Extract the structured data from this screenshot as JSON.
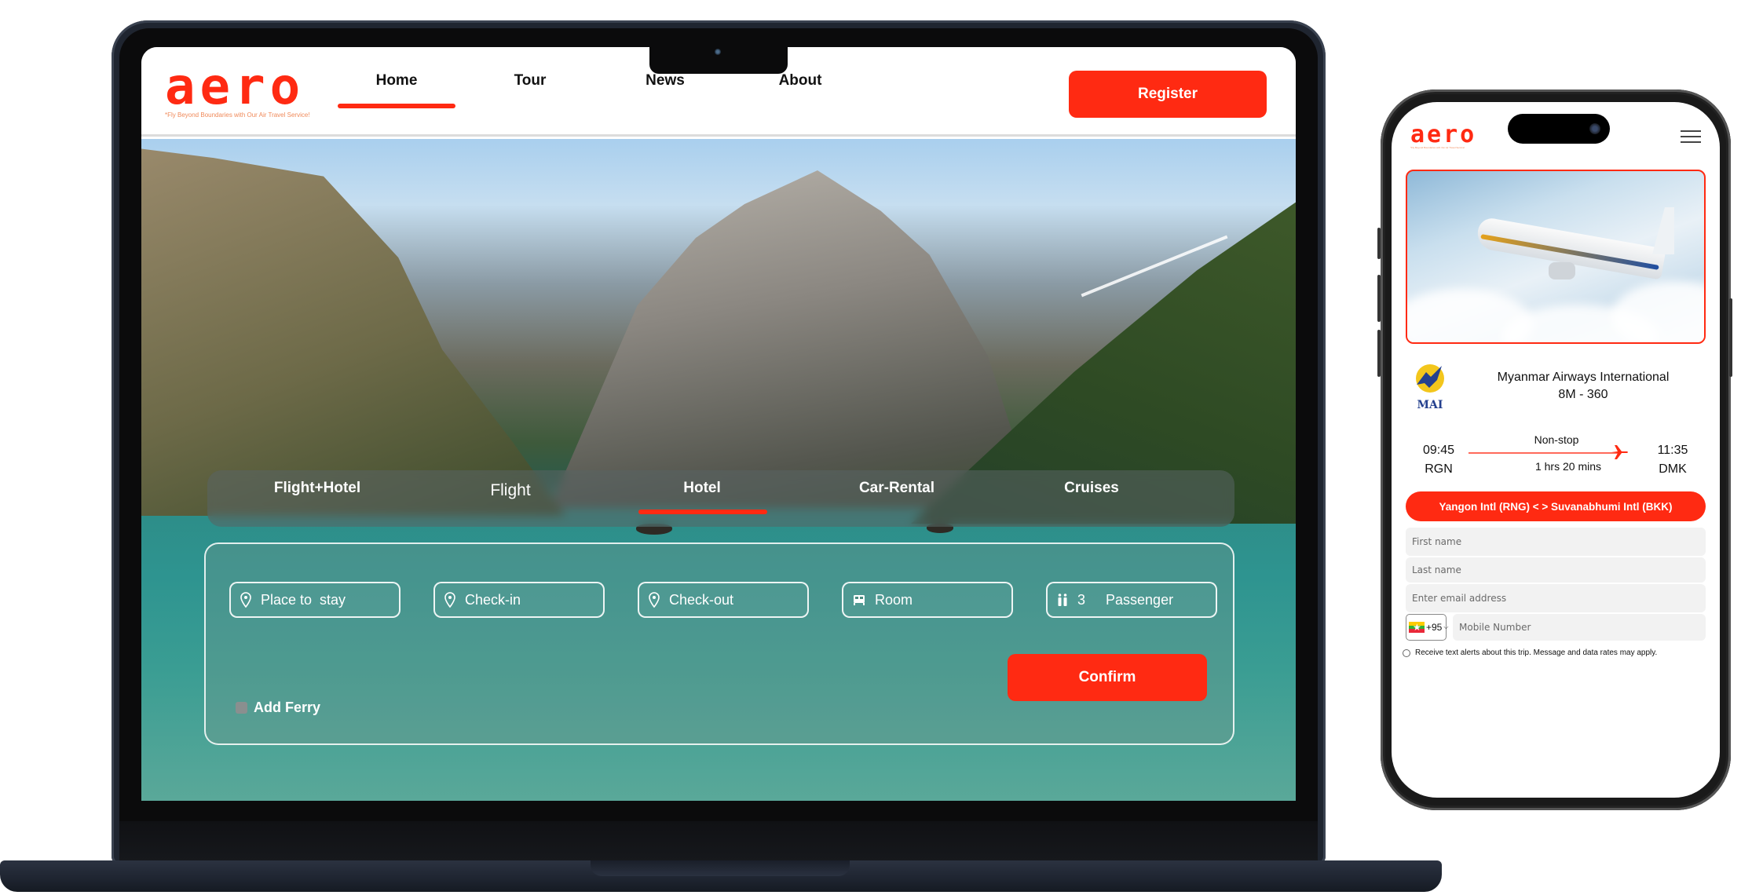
{
  "brand": {
    "logo_text": "aero",
    "tagline": "*Fly Beyond Boundaries with Our Air Travel Service!"
  },
  "desktop": {
    "nav": [
      {
        "label": "Home",
        "active": true
      },
      {
        "label": "Tour",
        "active": false
      },
      {
        "label": "News",
        "active": false
      },
      {
        "label": "About",
        "active": false
      }
    ],
    "register_label": "Register",
    "tabs": [
      {
        "label": "Flight+Hotel",
        "active": false
      },
      {
        "label": "Flight",
        "active": false
      },
      {
        "label": "Hotel",
        "active": true
      },
      {
        "label": "Car-Rental",
        "active": false
      },
      {
        "label": "Cruises",
        "active": false
      }
    ],
    "fields": [
      {
        "icon": "map-pin-icon",
        "label": "Place to  stay"
      },
      {
        "icon": "map-pin-icon",
        "label": "Check-in"
      },
      {
        "icon": "map-pin-icon",
        "label": "Check-out"
      },
      {
        "icon": "bed-icon",
        "label": "Room"
      },
      {
        "icon": "passenger-icon",
        "count": "3",
        "label": "Passenger"
      }
    ],
    "confirm_label": "Confirm",
    "ferry_label": "Add Ferry",
    "ferry_checked": false
  },
  "mobile": {
    "menu_icon": "hamburger-icon",
    "airline": {
      "name": "Myanmar Airways International",
      "flight_no": "8M - 360",
      "logo_text": "MAI"
    },
    "departure": {
      "time": "09:45",
      "code": "RGN"
    },
    "arrival": {
      "time": "11:35",
      "code": "DMK"
    },
    "stops": "Non-stop",
    "duration": "1 hrs 20 mins",
    "route": "Yangon Intl (RNG) < > Suvanabhumi Intl (BKK)",
    "form": {
      "first_name_placeholder": "First name",
      "last_name_placeholder": "Last name",
      "email_placeholder": "Enter email address",
      "country_code": "+95",
      "mobile_placeholder": "Mobile Number",
      "alerts_label": "Receive text alerts about this trip. Message and data rates may apply.",
      "alerts_checked": false
    }
  },
  "colors": {
    "accent": "#ff2a12",
    "laptop_body": "#1f2530",
    "input_bg": "#f2f2f2"
  }
}
